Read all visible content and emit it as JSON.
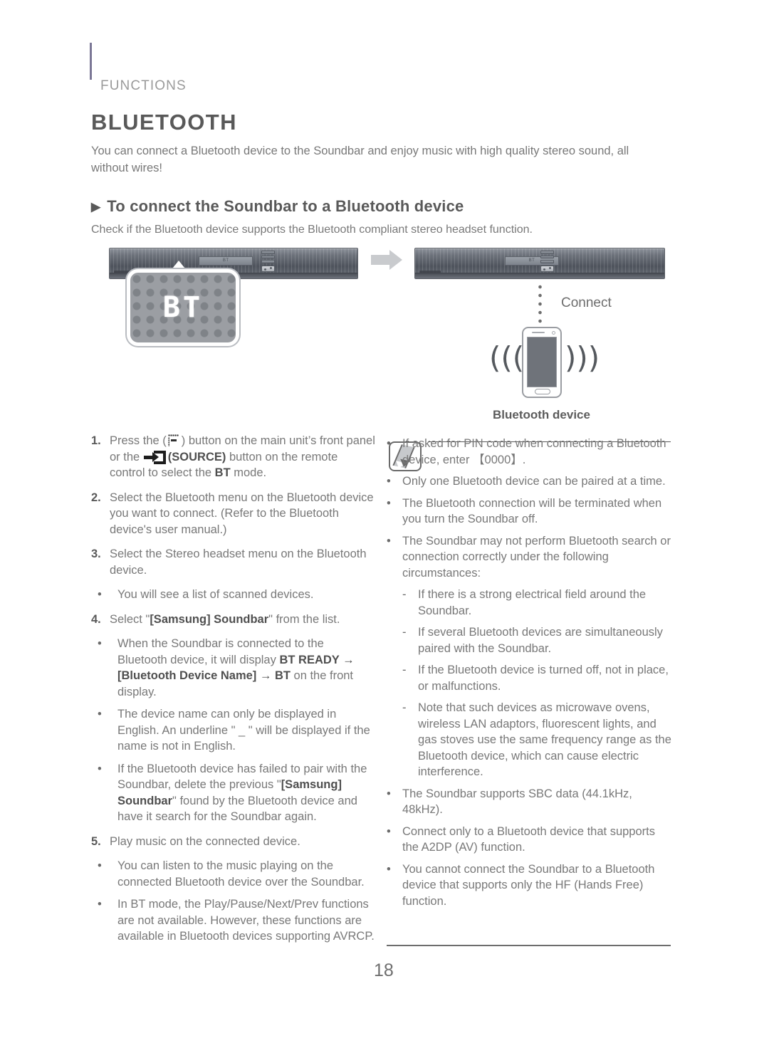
{
  "header": {
    "category": "FUNCTIONS",
    "title": "BLUETOOTH",
    "intro": "You can connect a Bluetooth device to the Soundbar and enjoy music with high quality stereo sound, all without wires!"
  },
  "section": {
    "marker": "▶",
    "heading": "To connect the Soundbar to a Bluetooth device",
    "subtext": "Check if the Bluetooth device supports the Bluetooth compliant stereo headset function."
  },
  "illustration": {
    "soundbar_display_text": "BT",
    "soundbar_window_label": "BT",
    "connect_label": "Connect",
    "device_label": "Bluetooth device",
    "wave_left": "(((",
    "wave_right": ")))"
  },
  "steps": [
    {
      "num": "1.",
      "parts": {
        "before_display": "Press the (",
        "after_display": ") button on the main unit’s front panel or the",
        "source_label": "(SOURCE)",
        "after_source": " button on the remote control to select the ",
        "mode": "BT",
        "tail": " mode."
      }
    },
    {
      "num": "2.",
      "text": "Select the Bluetooth menu on the Bluetooth device you want to connect. (Refer to the Bluetooth device's user manual.)"
    },
    {
      "num": "3.",
      "text": "Select the Stereo headset menu on the Bluetooth device.",
      "bullets": [
        {
          "marker": "•",
          "text": "You will see a list of scanned devices."
        }
      ]
    },
    {
      "num": "4.",
      "text_pre": "Select \"",
      "text_bold": "[Samsung] Soundbar",
      "text_post": "\" from the list.",
      "bullets": [
        {
          "marker": "•",
          "pre": "When the Soundbar is connected to the Bluetooth device, it will display ",
          "b1": "BT READY → [Bluetooth Device Name] → BT",
          "post": " on the front display."
        },
        {
          "marker": "•",
          "text": "The device name can only be displayed in English. An underline \" _ \" will be displayed if the name is not in English."
        },
        {
          "marker": "•",
          "pre": "If the Bluetooth device has failed to pair with the Soundbar, delete the previous \"",
          "b1": "[Samsung] Soundbar",
          "post": "\" found by the Bluetooth device and have it search for the Soundbar again."
        }
      ]
    },
    {
      "num": "5.",
      "text": "Play music on the connected device.",
      "bullets": [
        {
          "marker": "•",
          "text": "You can listen to the music playing on the connected Bluetooth device over the Soundbar."
        },
        {
          "marker": "•",
          "text": "In BT mode, the Play/Pause/Next/Prev functions are not available. However, these functions are available in Bluetooth devices supporting AVRCP."
        }
      ]
    }
  ],
  "notes": [
    {
      "marker": "•",
      "text": "If asked for PIN code when connecting a Bluetooth device, enter 【0000】."
    },
    {
      "marker": "•",
      "text": "Only one Bluetooth device can be paired at a time."
    },
    {
      "marker": "•",
      "text": "The Bluetooth connection will be terminated when you turn the Soundbar off."
    },
    {
      "marker": "•",
      "text": "The Soundbar may not perform Bluetooth search or connection correctly under the following circumstances:",
      "sub": [
        {
          "marker": "-",
          "text": "If there is a strong electrical field around the Soundbar."
        },
        {
          "marker": "-",
          "text": "If several Bluetooth devices are simultaneously paired with the Soundbar."
        },
        {
          "marker": "-",
          "text": "If the Bluetooth device is turned off, not in place, or malfunctions."
        },
        {
          "marker": "-",
          "text": "Note that such devices as microwave ovens, wireless LAN adaptors, fluorescent lights, and gas stoves use the same frequency range as the Bluetooth device, which can cause electric interference."
        }
      ]
    },
    {
      "marker": "•",
      "text": "The Soundbar supports SBC data (44.1kHz, 48kHz)."
    },
    {
      "marker": "•",
      "text": "Connect only to a Bluetooth device that supports the A2DP (AV) function."
    },
    {
      "marker": "•",
      "text": "You cannot connect the Soundbar to a Bluetooth device that supports only the HF (Hands Free) function."
    }
  ],
  "footer": {
    "page_number": "18"
  },
  "colors": {
    "accent_bar": "#7b7796",
    "body_text": "#787878",
    "heading_text": "#595959"
  }
}
